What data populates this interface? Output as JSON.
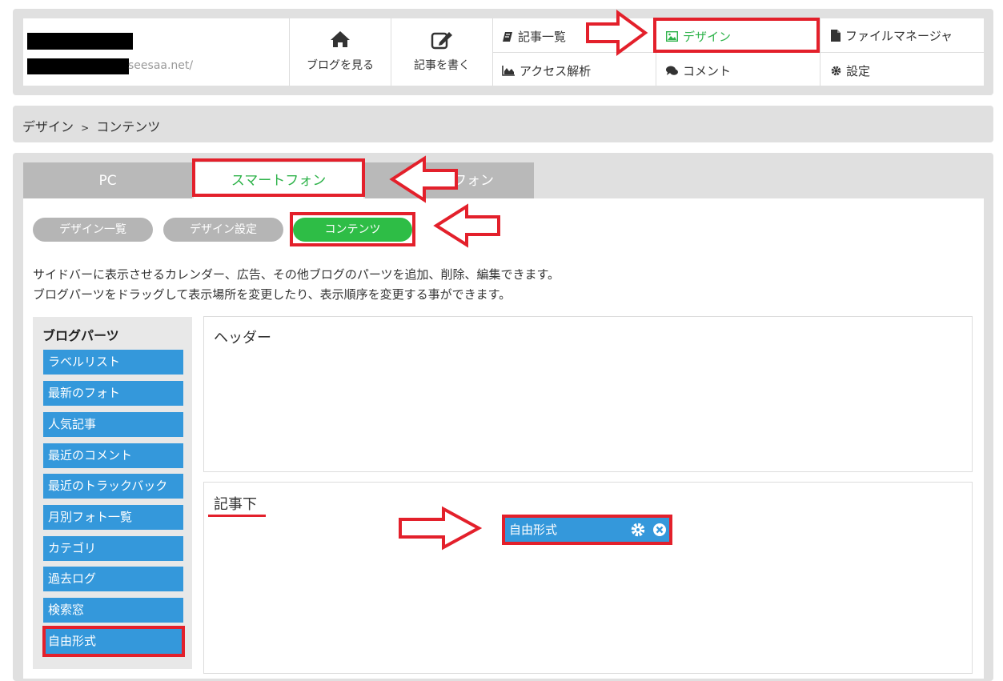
{
  "header": {
    "domain_suffix": "seesaa.net/",
    "nav_buttons": [
      {
        "label": "ブログを見る",
        "icon": "home-icon"
      },
      {
        "label": "記事を書く",
        "icon": "edit-icon"
      }
    ],
    "menu": [
      {
        "label": "記事一覧",
        "icon": "book-icon"
      },
      {
        "label": "デザイン",
        "icon": "image-icon",
        "active": true
      },
      {
        "label": "ファイルマネージャ",
        "icon": "file-icon"
      },
      {
        "label": "アクセス解析",
        "icon": "area-chart-icon"
      },
      {
        "label": "コメント",
        "icon": "comments-icon"
      },
      {
        "label": "設定",
        "icon": "gear-icon"
      }
    ]
  },
  "breadcrumb": {
    "parent": "デザイン",
    "separator": ">",
    "current": "コンテンツ"
  },
  "device_tabs": [
    {
      "label": "PC"
    },
    {
      "label": "スマートフォン",
      "active": true
    },
    {
      "label": "フォン",
      "partially_hidden": true
    }
  ],
  "sub_tabs": [
    {
      "label": "デザイン一覧"
    },
    {
      "label": "デザイン設定"
    },
    {
      "label": "コンテンツ",
      "active": true
    }
  ],
  "description": [
    "サイドバーに表示させるカレンダー、広告、その他ブログのパーツを追加、削除、編集できます。",
    "ブログパーツをドラッグして表示場所を変更したり、表示順序を変更する事ができます。"
  ],
  "parts_panel": {
    "title": "ブログパーツ",
    "items": [
      "ラベルリスト",
      "最新のフォト",
      "人気記事",
      "最近のコメント",
      "最近のトラックバック",
      "月別フォト一覧",
      "カテゴリ",
      "過去ログ",
      "検索窓",
      "自由形式"
    ]
  },
  "zones": [
    {
      "title": "ヘッダー"
    },
    {
      "title": "記事下",
      "widget": {
        "label": "自由形式",
        "actions": [
          "gear-icon",
          "close-icon"
        ]
      }
    }
  ],
  "colors": {
    "accent_green": "#2eb34a",
    "part_blue": "#3498db",
    "annotation_red": "#e3202b"
  }
}
